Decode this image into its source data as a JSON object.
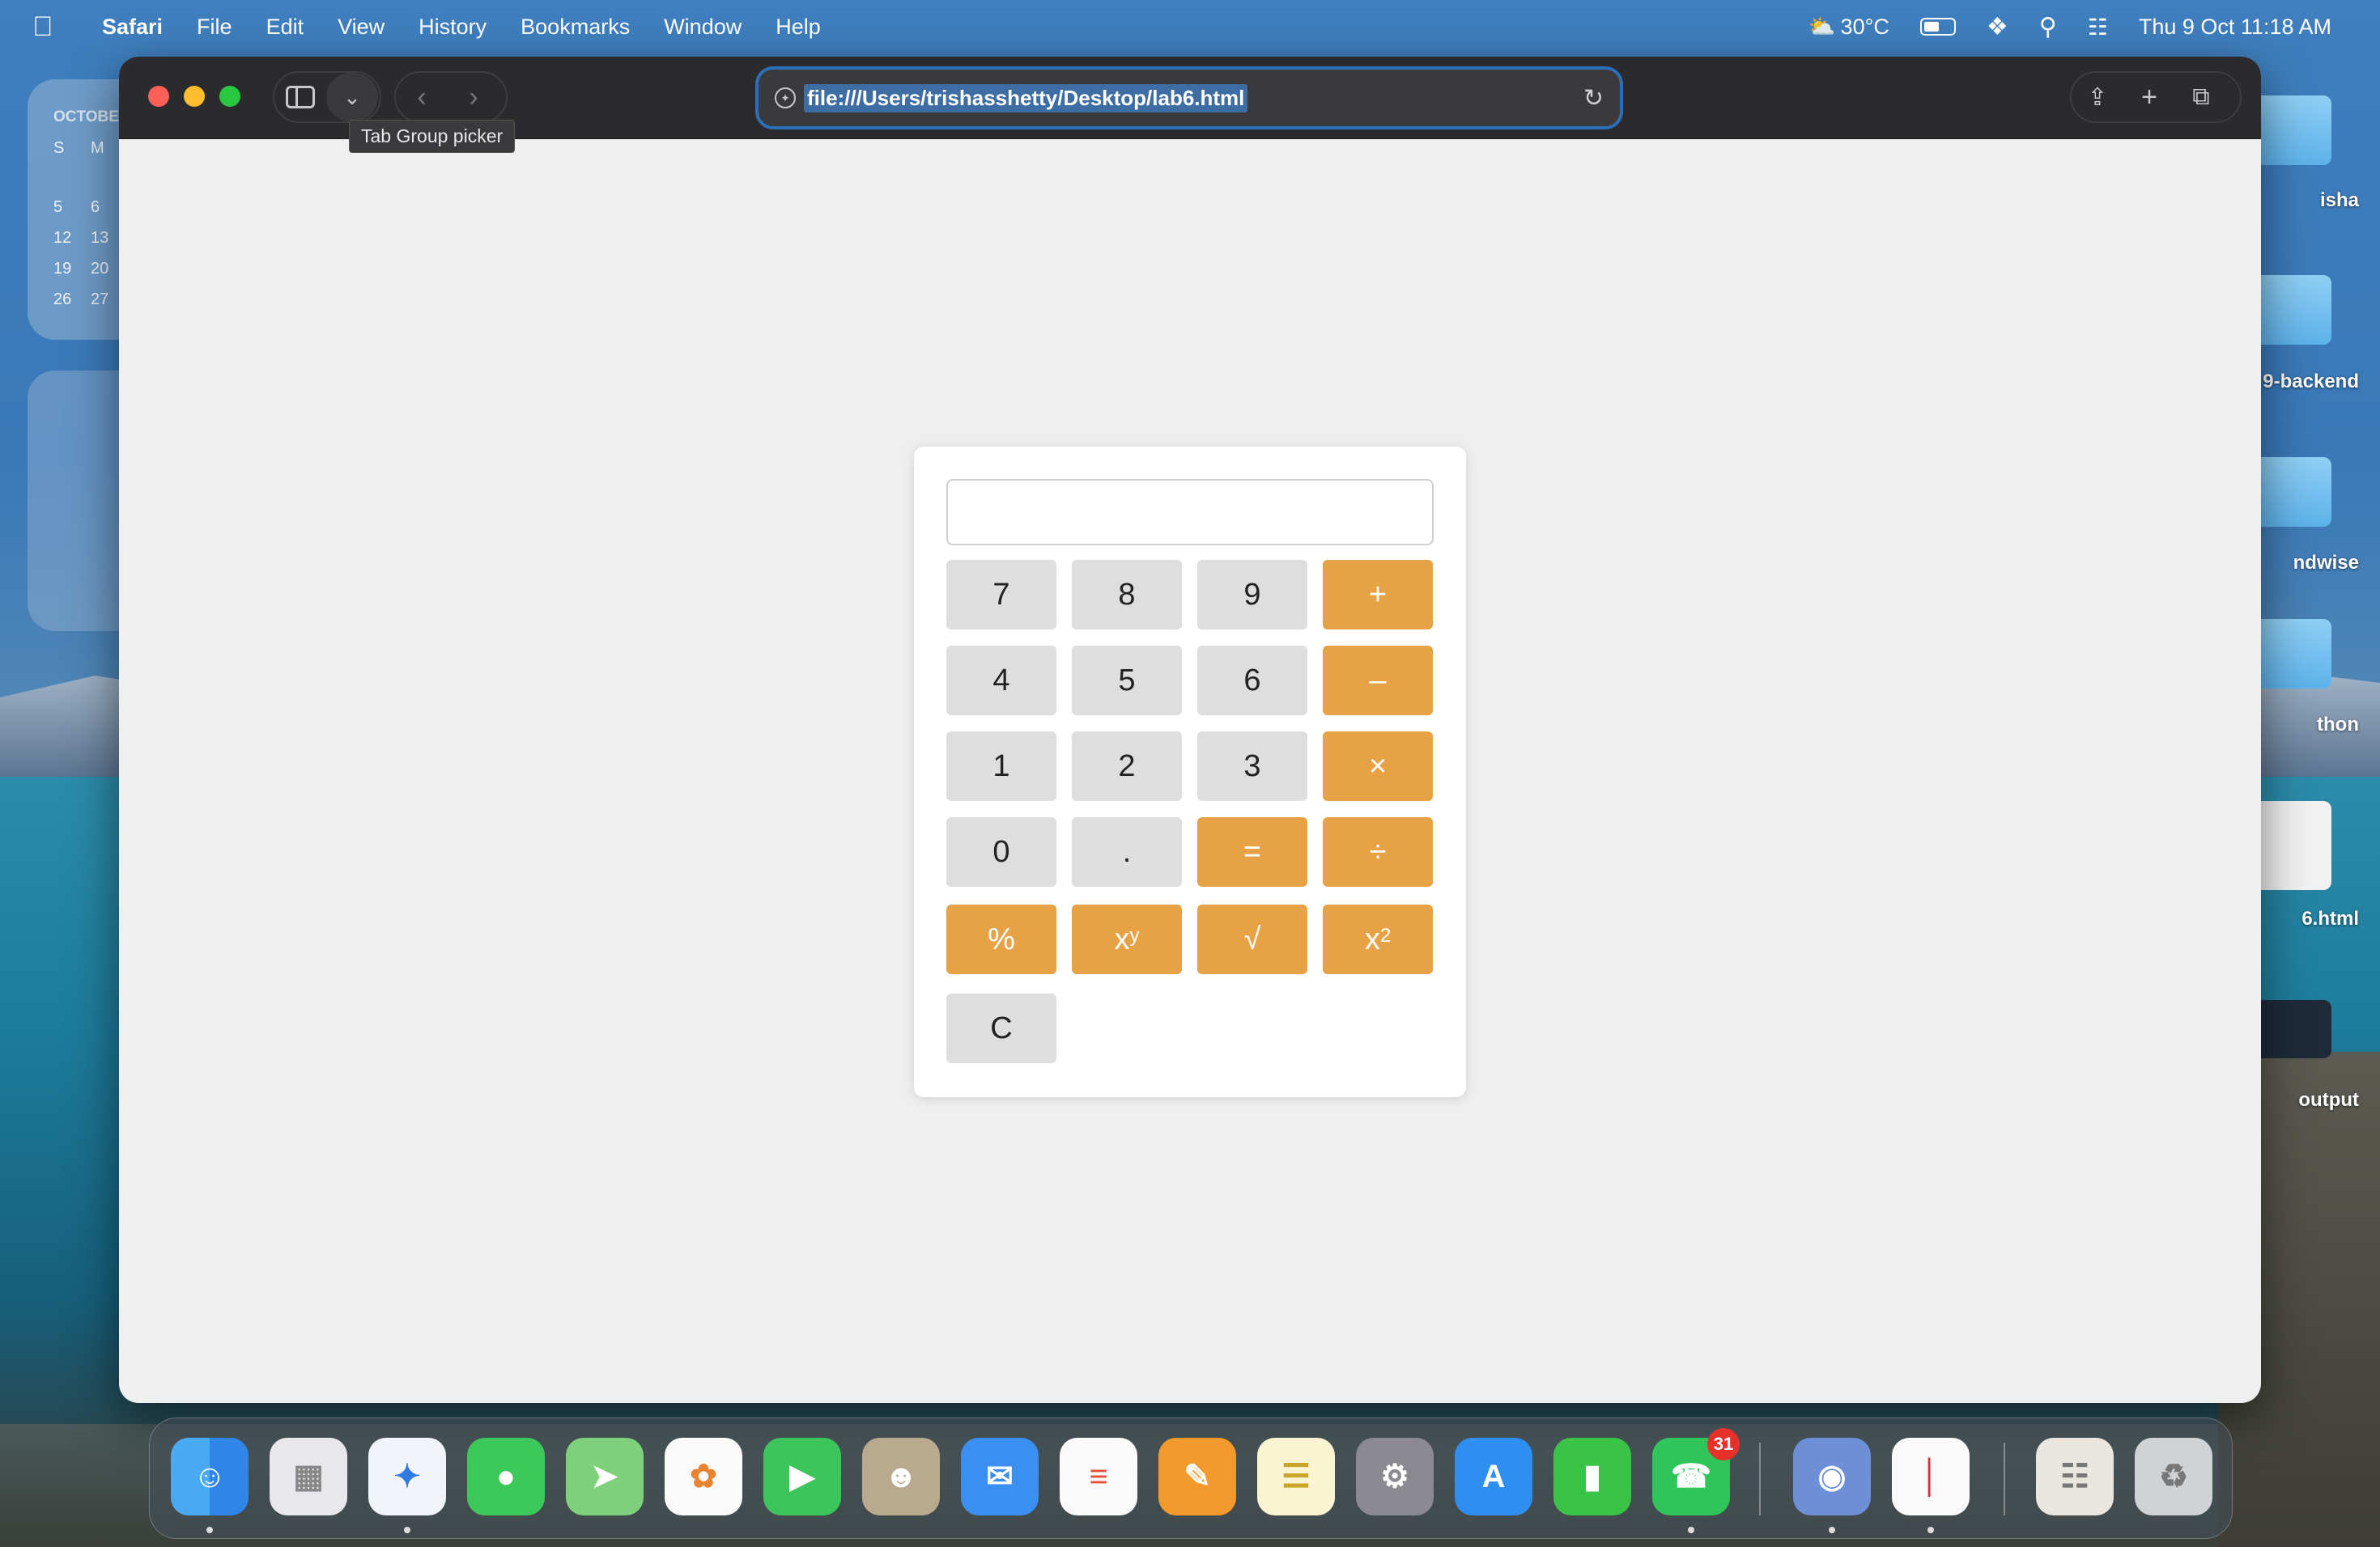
{
  "menubar": {
    "app": "Safari",
    "items": [
      "File",
      "Edit",
      "View",
      "History",
      "Bookmarks",
      "Window",
      "Help"
    ],
    "weather": "30°C",
    "datetime": "Thu 9 Oct  11:18 AM"
  },
  "widget": {
    "month": "OCTOBE",
    "weekdays": [
      "S",
      "M"
    ],
    "rows": [
      [
        "5",
        "6"
      ],
      [
        "12",
        "13"
      ],
      [
        "19",
        "20"
      ],
      [
        "26",
        "27"
      ]
    ]
  },
  "desktop": {
    "labels": [
      "isha",
      "9-backend",
      "ndwise",
      "thon",
      "6.html",
      "output"
    ]
  },
  "browser": {
    "url": "file:///Users/trishasshetty/Desktop/lab6.html",
    "tooltip": "Tab Group picker"
  },
  "calculator": {
    "display_value": "",
    "keys": [
      {
        "label": "7",
        "type": "num"
      },
      {
        "label": "8",
        "type": "num"
      },
      {
        "label": "9",
        "type": "num"
      },
      {
        "label": "+",
        "type": "op"
      },
      {
        "label": "4",
        "type": "num"
      },
      {
        "label": "5",
        "type": "num"
      },
      {
        "label": "6",
        "type": "num"
      },
      {
        "label": "–",
        "type": "op"
      },
      {
        "label": "1",
        "type": "num"
      },
      {
        "label": "2",
        "type": "num"
      },
      {
        "label": "3",
        "type": "num"
      },
      {
        "label": "×",
        "type": "op"
      },
      {
        "label": "0",
        "type": "num"
      },
      {
        "label": ".",
        "type": "num"
      },
      {
        "label": "=",
        "type": "op"
      },
      {
        "label": "÷",
        "type": "op"
      },
      {
        "label": "%",
        "type": "op"
      },
      {
        "label": "x",
        "sup": "y",
        "type": "op"
      },
      {
        "label": "√",
        "type": "op"
      },
      {
        "label": "x",
        "sup": "2",
        "type": "op"
      },
      {
        "label": "C",
        "type": "num"
      }
    ],
    "colors": {
      "operator": "#e8a246",
      "number": "#dedede"
    }
  },
  "dock": {
    "whatsapp_badge": "31",
    "apps": [
      "finder",
      "launchpad",
      "safari",
      "messages",
      "maps",
      "photos",
      "facetime",
      "contacts",
      "mail",
      "reminders",
      "pages",
      "notes",
      "system-settings",
      "app-store",
      "numbers",
      "whatsapp",
      "preview",
      "textedit",
      "documents",
      "trash"
    ]
  }
}
